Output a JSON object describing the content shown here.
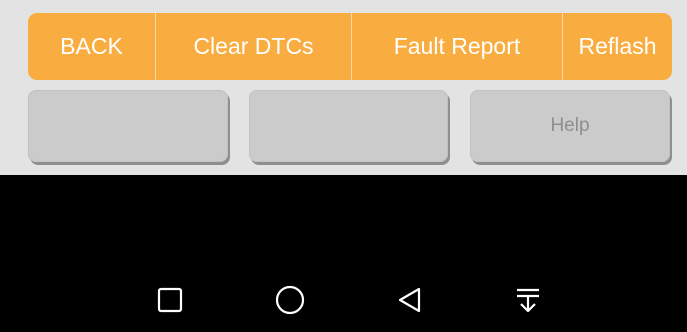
{
  "toolbar": {
    "back_label": "BACK",
    "clear_dtcs_label": "Clear DTCs",
    "fault_report_label": "Fault Report",
    "reflash_label": "Reflash"
  },
  "secondary_buttons": {
    "button1_label": "",
    "button2_label": "",
    "help_label": "Help"
  },
  "navbar": {
    "icons": [
      "square-recents-icon",
      "circle-home-icon",
      "triangle-back-icon",
      "notification-pulldown-icon"
    ]
  },
  "colors": {
    "toolbar_orange": "#f9ad41",
    "panel_grey": "#e3e3e3",
    "button_grey": "#cbcbcb",
    "navbar_black": "#000000"
  }
}
